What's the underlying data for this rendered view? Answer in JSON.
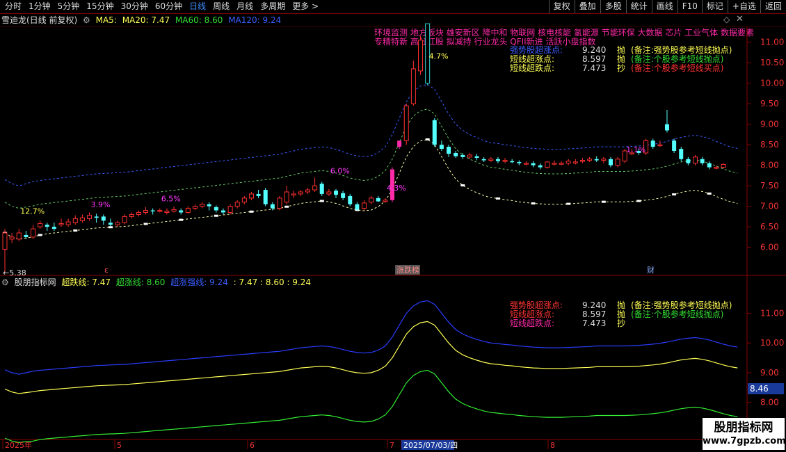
{
  "toolbar": {
    "periods": [
      "分时",
      "1分钟",
      "5分钟",
      "15分钟",
      "30分钟",
      "60分钟",
      "日线",
      "周线",
      "月线",
      "多周期",
      "更多 >"
    ],
    "active_period": "日线",
    "buttons": [
      "复权",
      "叠加",
      "多股",
      "统计",
      "画线",
      "F10",
      "标记",
      "+自选",
      "返回"
    ]
  },
  "main_header": {
    "stock": "雪迪龙(日线 前复权)",
    "ma5": "MA5:",
    "ma20": "MA20: 7.47",
    "ma60": "MA60: 8.60",
    "ma120": "MA120: 9.24"
  },
  "concepts": {
    "line1": "环境监测 地方板块 雄安新区 降中和 物联网 核电核能 氢能源 节能环保 大数据 芯片 工业气体 数据要素",
    "line2": "专精特新 高分红股 拟减持 行业龙头 QFII新进 活跃小盘指数"
  },
  "legend_main": [
    {
      "label": "强势股超涨点:",
      "value": "9.240",
      "tag": "抛",
      "note": "(备注:强势股参考短线抛点)",
      "label_color": "#3a5dff",
      "note_color": "#ffff55"
    },
    {
      "label": "短线超涨点:",
      "value": "8.597",
      "tag": "抛",
      "note": "(备注:个股参考短线抛点)",
      "label_color": "#ffff55",
      "note_color": "#33dd33"
    },
    {
      "label": "短线超跌点:",
      "value": "7.473",
      "tag": "抄",
      "note": "(备注:个股参考短线买点)",
      "label_color": "#ffff55",
      "note_color": "#ff3333"
    }
  ],
  "legend_sub": [
    {
      "label": "强势股超涨点:",
      "value": "9.240",
      "tag": "抛",
      "note": "(备注:强势股参考短线抛点)"
    },
    {
      "label": "短线超涨点:",
      "value": "8.597",
      "tag": "抛",
      "note": "(备注:个股参考短线抛点)"
    },
    {
      "label": "短线超跌点:",
      "value": "7.473",
      "tag": "抄",
      "note": ""
    }
  ],
  "price_axis": [
    "11.00",
    "10.50",
    "10.00",
    "9.50",
    "9.00",
    "8.50",
    "8.00",
    "7.50",
    "7.00",
    "6.50",
    "6.00"
  ],
  "sub_axis": [
    "11.00",
    "10.00",
    "9.00",
    "8.00",
    "7.00"
  ],
  "sub_current": "8.46",
  "low_marker": "←5.38",
  "high_marker": "",
  "pct_labels": [
    "12.7%",
    "3.9%",
    "6.5%",
    "6.0%",
    "4.3%",
    "4.7%",
    "1.1%"
  ],
  "event_tags": [
    "ε",
    "涨跌榜",
    "财"
  ],
  "sub_header": {
    "name": "股朋指标网",
    "down": "超跌线: 7.47",
    "up": "超涨线: 8.60",
    "strong": "超涨强线: 9.24",
    "values": ": 7.47  : 8.60  : 9.24"
  },
  "date_axis": [
    "2025年",
    "5",
    "6",
    "7",
    "2025/07/03/四",
    "8"
  ],
  "watermark": {
    "title": "股朋指标网",
    "url": "www.7gpzb.com"
  },
  "colors": {
    "up": "#ff3030",
    "down": "#54ffff",
    "strong": "#2a3cff",
    "upline": "#ffff55",
    "downline": "#33ee33",
    "border": "#8b0000"
  },
  "chart_data": {
    "type": "candlestick",
    "price_range": [
      5.35,
      11.35
    ],
    "sub_range": [
      6.8,
      11.9
    ],
    "candles": [
      [
        5.95,
        6.35,
        6.45,
        5.38
      ],
      [
        6.2,
        6.25,
        6.35,
        6.1
      ],
      [
        6.2,
        6.35,
        6.45,
        6.15
      ],
      [
        6.3,
        6.25,
        6.4,
        6.2
      ],
      [
        6.25,
        6.45,
        6.55,
        6.2
      ],
      [
        6.5,
        6.58,
        6.65,
        6.45
      ],
      [
        6.55,
        6.5,
        6.6,
        6.4
      ],
      [
        6.5,
        6.45,
        6.6,
        6.4
      ],
      [
        6.55,
        6.58,
        6.7,
        6.5
      ],
      [
        6.55,
        6.62,
        6.7,
        6.5
      ],
      [
        6.6,
        6.7,
        6.78,
        6.55
      ],
      [
        6.65,
        6.72,
        6.8,
        6.6
      ],
      [
        6.7,
        6.78,
        6.85,
        6.65
      ],
      [
        6.75,
        6.72,
        6.82,
        6.6
      ],
      [
        6.75,
        6.65,
        6.8,
        6.55
      ],
      [
        6.6,
        6.55,
        6.7,
        6.5
      ],
      [
        6.55,
        6.6,
        6.65,
        6.5
      ],
      [
        6.6,
        6.75,
        6.8,
        6.55
      ],
      [
        6.75,
        6.8,
        6.85,
        6.7
      ],
      [
        6.8,
        6.85,
        6.9,
        6.75
      ],
      [
        6.85,
        6.9,
        6.98,
        6.8
      ],
      [
        6.9,
        6.88,
        6.95,
        6.8
      ],
      [
        6.9,
        6.9,
        6.95,
        6.85
      ],
      [
        6.85,
        6.88,
        6.95,
        6.8
      ],
      [
        6.88,
        6.92,
        7.0,
        6.85
      ],
      [
        6.9,
        6.85,
        6.95,
        6.8
      ],
      [
        6.85,
        6.95,
        7.0,
        6.82
      ],
      [
        6.95,
        7.0,
        7.05,
        6.9
      ],
      [
        7.0,
        7.05,
        7.1,
        6.95
      ],
      [
        7.05,
        7.0,
        7.1,
        6.9
      ],
      [
        6.98,
        6.9,
        7.02,
        6.85
      ],
      [
        6.9,
        6.85,
        6.95,
        6.8
      ],
      [
        6.85,
        7.0,
        7.05,
        6.8
      ],
      [
        7.0,
        7.1,
        7.15,
        6.95
      ],
      [
        7.1,
        7.2,
        7.25,
        7.05
      ],
      [
        7.2,
        7.3,
        7.35,
        7.15
      ],
      [
        7.3,
        7.25,
        7.4,
        7.2
      ],
      [
        7.4,
        7.05,
        7.45,
        7.0
      ],
      [
        7.05,
        6.95,
        7.1,
        6.9
      ],
      [
        6.95,
        7.2,
        7.25,
        6.9
      ],
      [
        7.1,
        7.35,
        7.5,
        7.05
      ],
      [
        7.3,
        7.3,
        7.38,
        7.2
      ],
      [
        7.3,
        7.35,
        7.4,
        7.25
      ],
      [
        7.35,
        7.4,
        7.45,
        7.3
      ],
      [
        7.4,
        7.5,
        7.7,
        7.35
      ],
      [
        7.55,
        7.3,
        7.6,
        7.25
      ],
      [
        7.3,
        7.35,
        7.42,
        7.25
      ],
      [
        7.38,
        7.28,
        7.42,
        7.2
      ],
      [
        7.32,
        7.2,
        7.38,
        7.15
      ],
      [
        7.25,
        7.05,
        7.3,
        7.0
      ],
      [
        7.05,
        6.92,
        7.1,
        6.9
      ],
      [
        6.95,
        7.08,
        7.15,
        6.9
      ],
      [
        7.1,
        7.2,
        7.25,
        7.05
      ],
      [
        7.2,
        7.12,
        7.25,
        7.1
      ],
      [
        7.12,
        7.15,
        7.2,
        7.08
      ],
      [
        7.15,
        7.9,
        7.95,
        7.1
      ],
      [
        8.45,
        8.6,
        8.6,
        8.4
      ],
      [
        8.6,
        9.45,
        9.5,
        8.5
      ],
      [
        9.5,
        10.35,
        10.55,
        9.45
      ],
      [
        10.3,
        11.05,
        11.15,
        10.2
      ],
      [
        10.0,
        11.45,
        11.45,
        9.95
      ],
      [
        9.1,
        8.5,
        9.15,
        8.45
      ],
      [
        8.5,
        8.4,
        8.6,
        8.35
      ],
      [
        8.45,
        8.28,
        8.5,
        8.2
      ],
      [
        8.3,
        8.22,
        8.35,
        8.18
      ],
      [
        8.25,
        8.2,
        8.3,
        8.15
      ],
      [
        8.2,
        8.25,
        8.3,
        8.15
      ],
      [
        8.22,
        8.18,
        8.28,
        8.12
      ],
      [
        8.15,
        8.12,
        8.2,
        8.08
      ],
      [
        8.12,
        8.15,
        8.2,
        8.08
      ],
      [
        8.15,
        8.1,
        8.2,
        8.05
      ],
      [
        8.1,
        8.12,
        8.18,
        8.05
      ],
      [
        8.1,
        8.08,
        8.15,
        8.05
      ],
      [
        8.08,
        8.05,
        8.12,
        8.0
      ],
      [
        8.05,
        8.05,
        8.1,
        8.0
      ],
      [
        8.05,
        8.0,
        8.1,
        7.95
      ],
      [
        8.0,
        7.95,
        8.05,
        7.9
      ],
      [
        7.95,
        8.08,
        8.1,
        7.92
      ],
      [
        8.05,
        8.05,
        8.12,
        8.0
      ],
      [
        8.05,
        8.05,
        8.1,
        8.0
      ],
      [
        8.05,
        8.1,
        8.15,
        8.0
      ],
      [
        8.08,
        8.08,
        8.15,
        8.02
      ],
      [
        8.1,
        8.12,
        8.18,
        8.05
      ],
      [
        8.12,
        8.15,
        8.2,
        8.08
      ],
      [
        8.15,
        8.12,
        8.22,
        8.08
      ],
      [
        8.12,
        8.15,
        8.2,
        8.05
      ],
      [
        8.15,
        8.0,
        8.2,
        7.95
      ],
      [
        8.0,
        8.15,
        8.2,
        7.95
      ],
      [
        8.1,
        8.35,
        8.4,
        8.05
      ],
      [
        8.3,
        8.3,
        8.4,
        8.25
      ],
      [
        8.35,
        8.3,
        8.4,
        8.25
      ],
      [
        8.3,
        8.6,
        8.65,
        8.25
      ],
      [
        8.6,
        8.45,
        8.65,
        8.4
      ],
      [
        8.5,
        8.5,
        8.6,
        8.45
      ],
      [
        9.0,
        8.85,
        9.35,
        8.8
      ],
      [
        8.6,
        8.35,
        8.65,
        8.3
      ],
      [
        8.4,
        8.15,
        8.45,
        8.1
      ],
      [
        8.15,
        8.05,
        8.2,
        8.0
      ],
      [
        8.05,
        8.2,
        8.25,
        8.0
      ],
      [
        8.15,
        8.05,
        8.2,
        8.0
      ],
      [
        8.05,
        7.95,
        8.1,
        7.9
      ],
      [
        7.95,
        7.95,
        8.0,
        7.9
      ],
      [
        7.95,
        8.02,
        8.05,
        7.92
      ]
    ],
    "strong_line": [
      9.1,
      9.0,
      8.95,
      9.0,
      9.05,
      9.08,
      9.1,
      9.12,
      9.14,
      9.16,
      9.18,
      9.2,
      9.22,
      9.24,
      9.25,
      9.26,
      9.27,
      9.28,
      9.3,
      9.32,
      9.34,
      9.36,
      9.38,
      9.4,
      9.42,
      9.44,
      9.46,
      9.48,
      9.5,
      9.52,
      9.54,
      9.56,
      9.58,
      9.6,
      9.62,
      9.64,
      9.66,
      9.68,
      9.7,
      9.72,
      9.76,
      9.8,
      9.84,
      9.86,
      9.88,
      9.9,
      9.88,
      9.84,
      9.78,
      9.72,
      9.68,
      9.66,
      9.68,
      9.76,
      9.9,
      10.2,
      10.6,
      11.0,
      11.25,
      11.38,
      11.42,
      11.3,
      11.0,
      10.7,
      10.45,
      10.3,
      10.2,
      10.12,
      10.05,
      10.0,
      9.98,
      9.95,
      9.93,
      9.9,
      9.88,
      9.86,
      9.85,
      9.84,
      9.84,
      9.84,
      9.85,
      9.86,
      9.87,
      9.88,
      9.9,
      9.9,
      9.9,
      9.9,
      9.9,
      9.91,
      9.92,
      9.94,
      9.96,
      9.99,
      10.03,
      10.08,
      10.13,
      10.16,
      10.18,
      10.15,
      10.1,
      10.03,
      9.96,
      9.9,
      9.86
    ],
    "up_line": [
      8.45,
      8.35,
      8.3,
      8.33,
      8.36,
      8.4,
      8.42,
      8.44,
      8.46,
      8.48,
      8.5,
      8.52,
      8.54,
      8.56,
      8.57,
      8.58,
      8.59,
      8.6,
      8.62,
      8.64,
      8.66,
      8.68,
      8.7,
      8.72,
      8.74,
      8.76,
      8.78,
      8.8,
      8.82,
      8.84,
      8.86,
      8.88,
      8.9,
      8.92,
      8.94,
      8.96,
      8.98,
      9.0,
      9.02,
      9.04,
      9.08,
      9.12,
      9.16,
      9.18,
      9.2,
      9.22,
      9.2,
      9.16,
      9.1,
      9.04,
      9.0,
      8.98,
      9.0,
      9.08,
      9.22,
      9.5,
      9.9,
      10.3,
      10.55,
      10.68,
      10.72,
      10.6,
      10.3,
      10.0,
      9.75,
      9.6,
      9.5,
      9.42,
      9.35,
      9.3,
      9.28,
      9.25,
      9.23,
      9.2,
      9.18,
      9.16,
      9.15,
      9.14,
      9.14,
      9.14,
      9.15,
      9.16,
      9.17,
      9.18,
      9.2,
      9.2,
      9.2,
      9.2,
      9.2,
      9.21,
      9.22,
      9.24,
      9.26,
      9.29,
      9.33,
      9.38,
      9.43,
      9.46,
      9.48,
      9.45,
      9.4,
      9.33,
      9.26,
      9.2,
      9.16
    ],
    "down_line": [
      7.6,
      7.5,
      7.45,
      7.48,
      7.5,
      7.55,
      7.58,
      7.6,
      7.62,
      7.64,
      7.66,
      7.68,
      7.7,
      7.72,
      7.73,
      7.74,
      7.75,
      7.76,
      7.78,
      7.8,
      7.82,
      7.84,
      7.86,
      7.88,
      7.9,
      7.92,
      7.94,
      7.96,
      7.98,
      8.0,
      8.02,
      8.04,
      8.06,
      8.08,
      8.1,
      8.12,
      8.14,
      8.16,
      8.18,
      8.2,
      8.24,
      8.28,
      8.32,
      8.34,
      8.36,
      8.38,
      8.36,
      8.32,
      8.26,
      8.2,
      8.16,
      8.14,
      8.16,
      8.24,
      8.38,
      8.66,
      9.06,
      9.46,
      9.71,
      9.84,
      9.88,
      9.76,
      9.46,
      9.16,
      8.91,
      8.76,
      8.66,
      8.58,
      8.51,
      8.46,
      8.44,
      8.41,
      8.39,
      8.36,
      8.34,
      8.32,
      8.31,
      8.3,
      8.3,
      8.3,
      8.31,
      8.32,
      8.33,
      8.34,
      8.36,
      8.36,
      8.36,
      8.36,
      8.36,
      8.37,
      8.38,
      8.4,
      8.42,
      8.45,
      8.49,
      8.54,
      8.59,
      8.62,
      8.64,
      8.61,
      8.56,
      8.49,
      8.42,
      8.36,
      8.32
    ]
  }
}
